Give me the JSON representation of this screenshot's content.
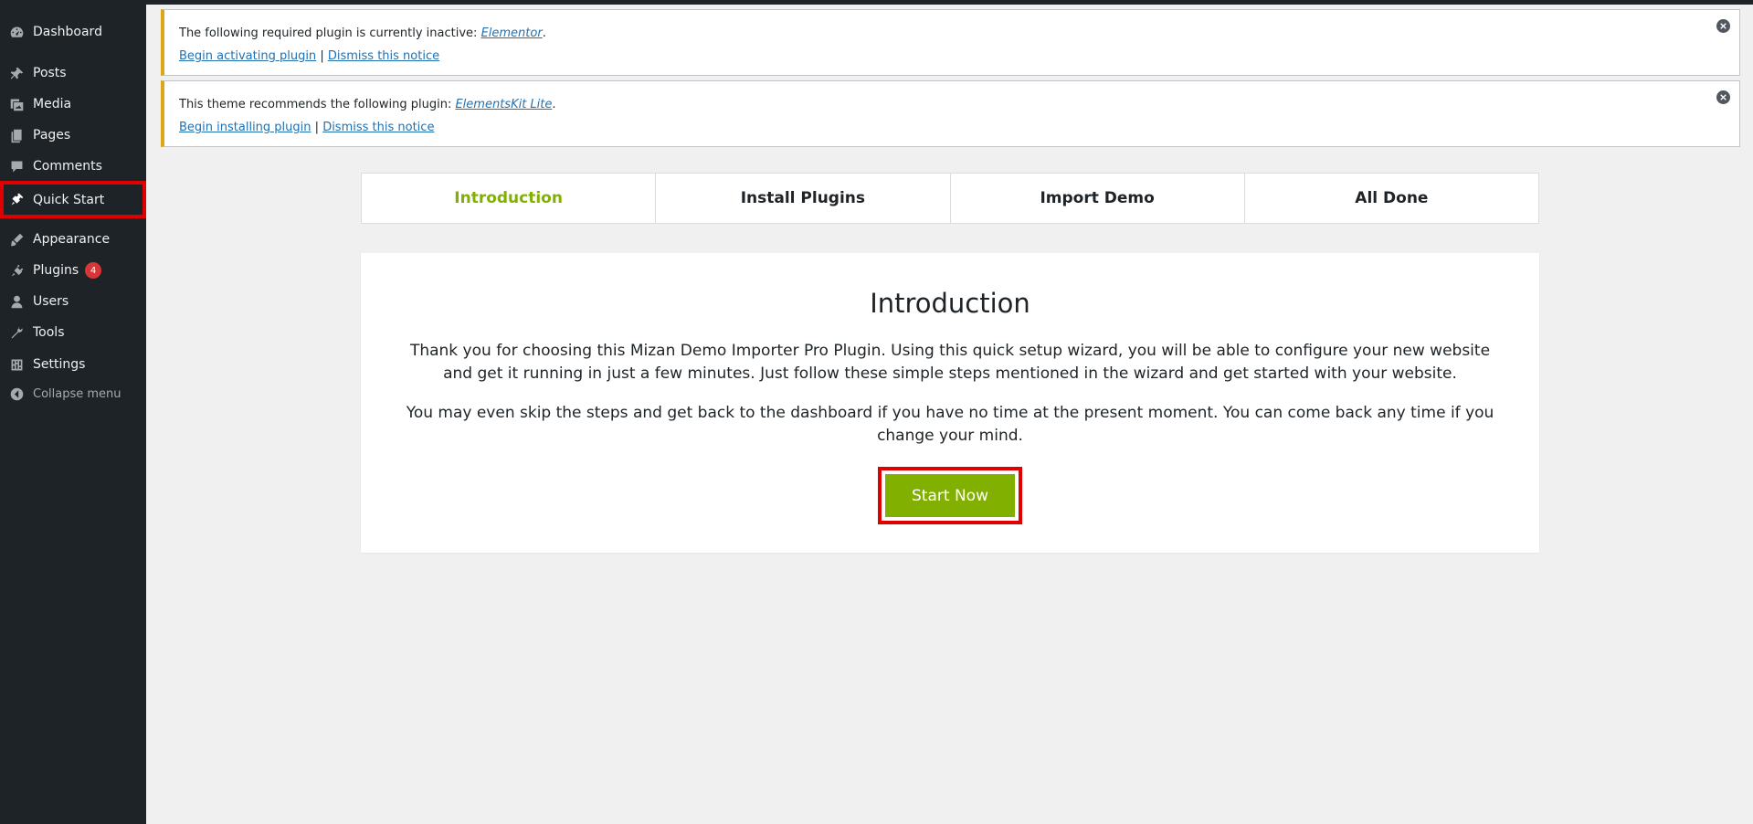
{
  "sidebar": {
    "items": [
      {
        "label": "Dashboard",
        "icon": "dashboard-icon"
      },
      {
        "label": "Posts",
        "icon": "pin-icon"
      },
      {
        "label": "Media",
        "icon": "media-icon"
      },
      {
        "label": "Pages",
        "icon": "pages-icon"
      },
      {
        "label": "Comments",
        "icon": "comment-icon"
      },
      {
        "label": "Quick Start",
        "icon": "quick-start-icon"
      },
      {
        "label": "Appearance",
        "icon": "brush-icon"
      },
      {
        "label": "Plugins",
        "icon": "plugin-icon",
        "badge": "4"
      },
      {
        "label": "Users",
        "icon": "user-icon"
      },
      {
        "label": "Tools",
        "icon": "wrench-icon"
      },
      {
        "label": "Settings",
        "icon": "settings-icon"
      },
      {
        "label": "Collapse menu",
        "icon": "collapse-icon"
      }
    ]
  },
  "notices": [
    {
      "text": "The following required plugin is currently inactive: ",
      "plugin": "Elementor",
      "action": "Begin activating plugin",
      "separator": "|",
      "dismiss": "Dismiss this notice"
    },
    {
      "text": "This theme recommends the following plugin: ",
      "plugin": "ElementsKit Lite",
      "action": "Begin installing plugin",
      "separator": "|",
      "dismiss": "Dismiss this notice"
    }
  ],
  "steps": [
    "Introduction",
    "Install Plugins",
    "Import Demo",
    "All Done"
  ],
  "card": {
    "title": "Introduction",
    "p1": "Thank you for choosing this Mizan Demo Importer Pro Plugin. Using this quick setup wizard, you will be able to configure your new website and get it running in just a few minutes. Just follow these simple steps mentioned in the wizard and get started with your website.",
    "p2": "You may even skip the steps and get back to the dashboard if you have no time at the present moment. You can come back any time if you change your mind.",
    "button": "Start Now"
  },
  "colors": {
    "sidebar_bg": "#1d2327",
    "accent_green": "#82b000",
    "notice_warning": "#dba617",
    "highlight_red": "#e00000",
    "link": "#2271b1"
  }
}
